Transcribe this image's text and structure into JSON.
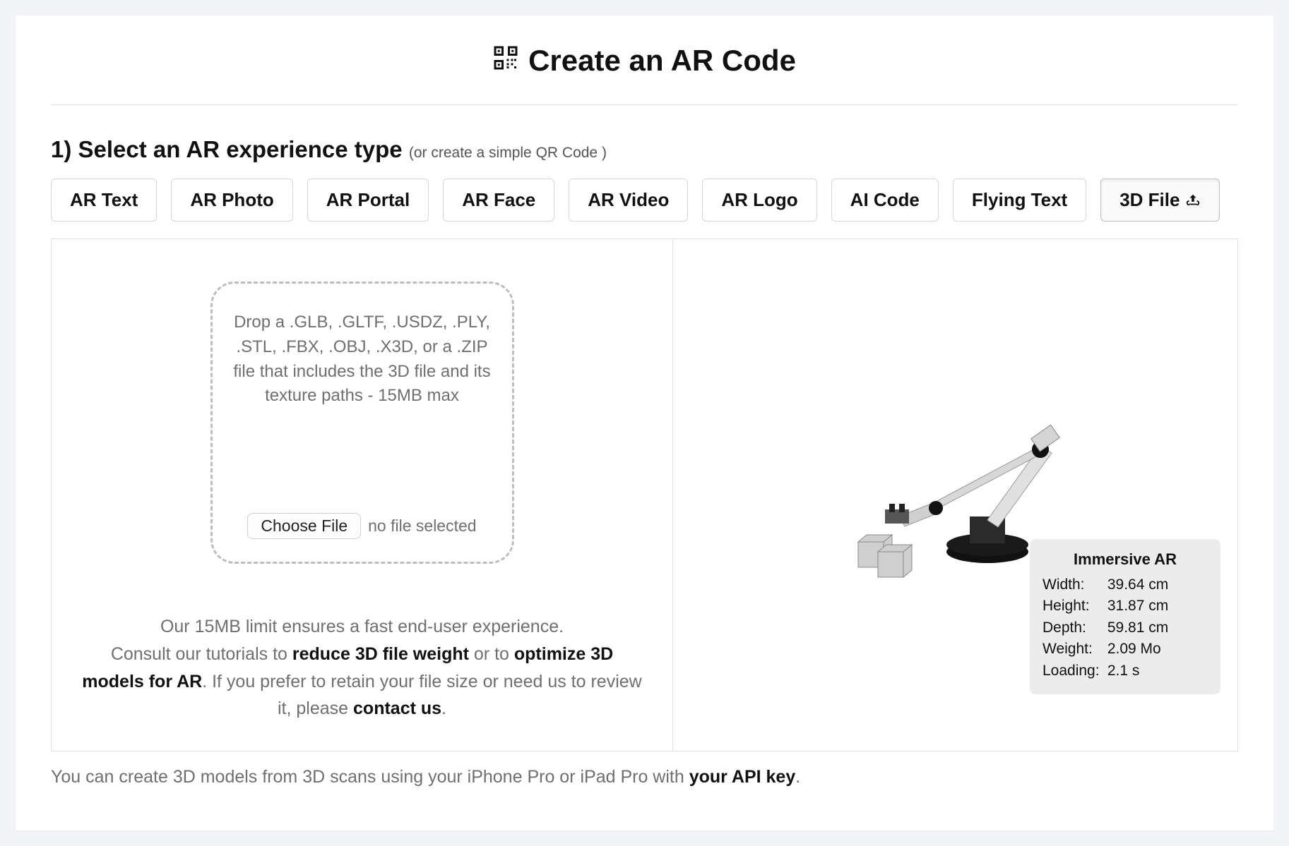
{
  "title": "Create an AR Code",
  "section1": {
    "title": "1) Select an AR experience type",
    "sub_before": "(or create a simple ",
    "sub_link": "QR Code",
    "sub_after": " )"
  },
  "tabs": [
    "AR Text",
    "AR Photo",
    "AR Portal",
    "AR Face",
    "AR Video",
    "AR Logo",
    "AI Code",
    "Flying Text",
    "3D File"
  ],
  "active_tab_index": 8,
  "dropzone": {
    "text": "Drop a .GLB, .GLTF, .USDZ, .PLY, .STL, .FBX, .OBJ, .X3D, or a .ZIP file that includes the 3D file and its texture paths - 15MB max",
    "choose_label": "Choose File",
    "no_file": "no file selected"
  },
  "help": {
    "line1": "Our 15MB limit ensures a fast end-user experience.",
    "line2a": "Consult our tutorials to ",
    "line2b": "reduce 3D file weight",
    "line2c": " or to ",
    "line2d": "optimize 3D models for AR",
    "line2e": ". If you prefer to retain your file size or need us to review it, please ",
    "line2f": "contact us",
    "line2g": "."
  },
  "info": {
    "title": "Immersive AR",
    "rows": [
      {
        "k": "Width:",
        "v": "39.64 cm"
      },
      {
        "k": "Height:",
        "v": "31.87 cm"
      },
      {
        "k": "Depth:",
        "v": "59.81 cm"
      },
      {
        "k": "Weight:",
        "v": "2.09 Mo"
      },
      {
        "k": "Loading:",
        "v": "2.1 s"
      }
    ]
  },
  "footnote": {
    "a": "You can create 3D models from 3D scans using your iPhone Pro or iPad Pro with ",
    "b": "your API key",
    "c": "."
  }
}
